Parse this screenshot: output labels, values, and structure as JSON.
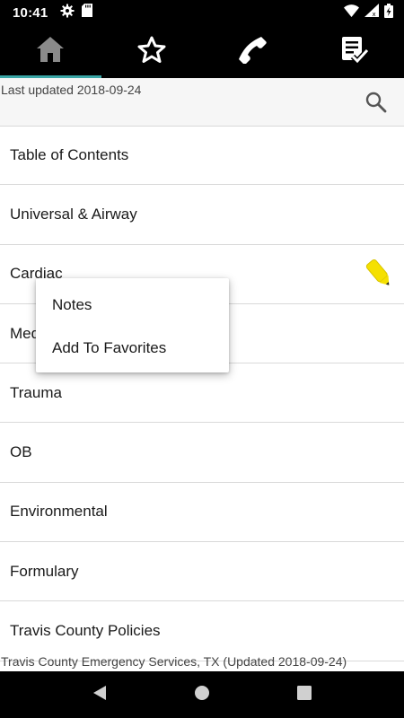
{
  "status_bar": {
    "time": "10:41",
    "icons_left": [
      "gear-icon",
      "sd-card-icon"
    ],
    "icons_right": [
      "wifi-icon",
      "signal-icon",
      "battery-charging-icon"
    ]
  },
  "top_nav": {
    "tabs": [
      {
        "name": "home",
        "icon": "home-icon",
        "active": true
      },
      {
        "name": "favorites",
        "icon": "star-icon",
        "active": false
      },
      {
        "name": "phone",
        "icon": "phone-icon",
        "active": false
      },
      {
        "name": "checklist",
        "icon": "checklist-icon",
        "active": false
      }
    ],
    "accent_color": "#3aa6a6"
  },
  "header": {
    "last_updated": "Last updated 2018-09-24",
    "search_icon": "search-icon"
  },
  "list": {
    "items": [
      {
        "label": "Table of Contents"
      },
      {
        "label": "Universal & Airway"
      },
      {
        "label": "Cardiac",
        "has_note": true,
        "note_icon": "pencil-icon"
      },
      {
        "label": "Medical"
      },
      {
        "label": "Trauma"
      },
      {
        "label": "OB"
      },
      {
        "label": "Environmental"
      },
      {
        "label": "Formulary"
      },
      {
        "label": "Travis County Policies"
      }
    ]
  },
  "popup_menu": {
    "items": [
      {
        "label": "Notes"
      },
      {
        "label": "Add To Favorites"
      }
    ]
  },
  "footer": {
    "text": "Travis County Emergency Services, TX (Updated 2018-09-24)"
  },
  "android_nav": {
    "buttons": [
      "back-icon",
      "home-circle-icon",
      "recents-icon"
    ]
  }
}
